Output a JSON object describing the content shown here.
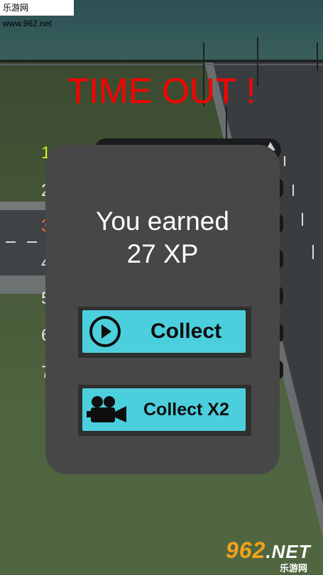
{
  "watermark": {
    "site_text": "乐游网 www.962.net",
    "logo_number": "962",
    "logo_domain": ".NET",
    "logo_cn": "乐游网"
  },
  "game": {
    "title": "TIME OUT !",
    "leaderboard_ranks": [
      "1",
      "2",
      "3",
      "4",
      "5",
      "6",
      "7"
    ]
  },
  "modal": {
    "earned_line1": "You earned",
    "earned_line2": "27 XP",
    "collect_label": "Collect",
    "collect_icon": "play-circle-icon",
    "collect_x2_label": "Collect X2",
    "collect_x2_icon": "video-camera-icon"
  },
  "colors": {
    "title": "#ff0000",
    "button_fill": "#4ccfdd",
    "modal_bg": "#474747",
    "rank_first": "#d6ee24",
    "rank_third": "#ff6a2a"
  }
}
